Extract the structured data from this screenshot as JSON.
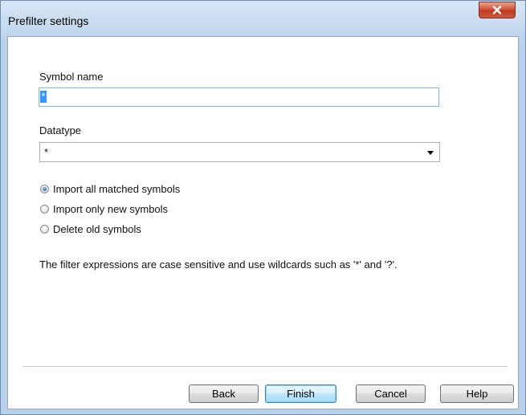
{
  "window": {
    "title": "Prefilter settings"
  },
  "form": {
    "symbol_name_label": "Symbol name",
    "symbol_name_value": "*",
    "datatype_label": "Datatype",
    "datatype_value": "*",
    "options": [
      {
        "label": "Import all matched symbols",
        "checked": true
      },
      {
        "label": "Import only new symbols",
        "checked": false
      },
      {
        "label": "Delete old symbols",
        "checked": false
      }
    ],
    "info_text": "The filter expressions are case sensitive and use wildcards such as '*' and '?'."
  },
  "buttons": {
    "back": "Back",
    "finish": "Finish",
    "cancel": "Cancel",
    "help": "Help"
  },
  "icons": {
    "close": "close-icon",
    "dropdown": "chevron-down-icon"
  },
  "colors": {
    "close_button": "#c9452a",
    "focus_border": "#7eb4ea",
    "selection": "#3399ff"
  }
}
